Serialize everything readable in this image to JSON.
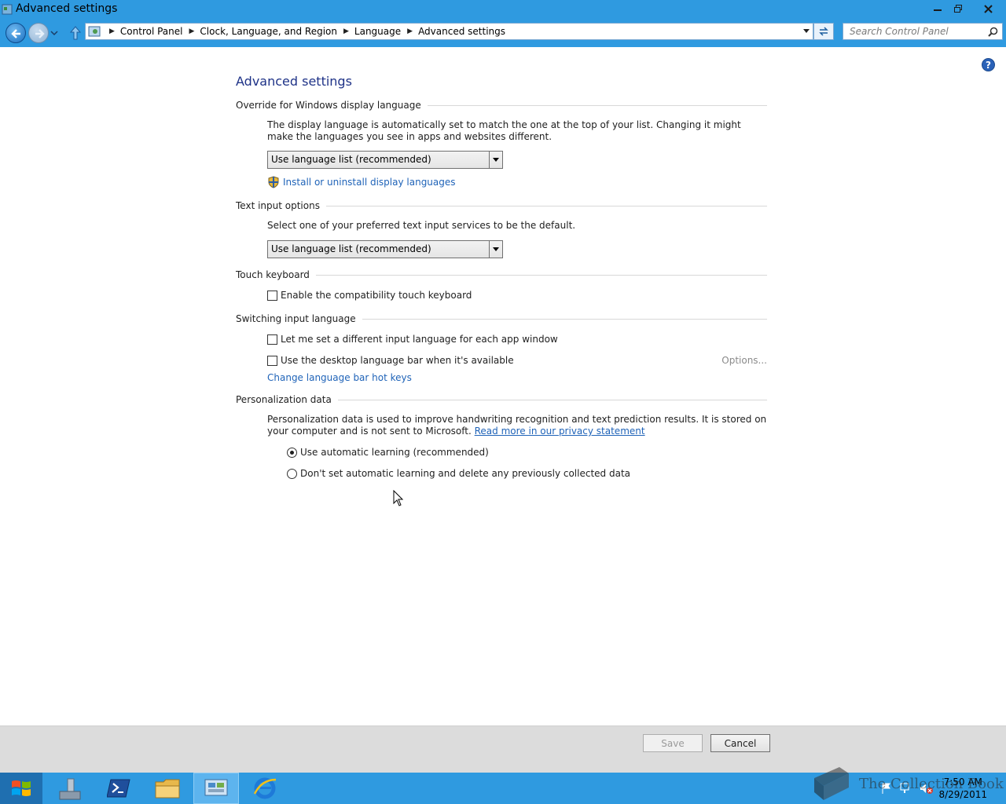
{
  "window": {
    "title": "Advanced settings",
    "minimize_label": "–",
    "restore_label": "▫",
    "close_label": "✕"
  },
  "address_bar": {
    "breadcrumbs": [
      "Control Panel",
      "Clock, Language, and Region",
      "Language",
      "Advanced settings"
    ],
    "search_placeholder": "Search Control Panel"
  },
  "page": {
    "title": "Advanced settings",
    "sections": {
      "display_language": {
        "heading": "Override for Windows display language",
        "description": "The display language is automatically set to match the one at the top of your list. Changing it might make the languages you see in apps and websites different.",
        "dropdown_value": "Use language list (recommended)",
        "link": "Install or uninstall display languages"
      },
      "text_input": {
        "heading": "Text input options",
        "description": "Select one of your preferred text input services to be the default.",
        "dropdown_value": "Use language list (recommended)"
      },
      "touch_keyboard": {
        "heading": "Touch keyboard",
        "checkbox_label": "Enable the compatibility touch keyboard",
        "checked": false
      },
      "switching": {
        "heading": "Switching input language",
        "checkbox1_label": "Let me set a different input language for each app window",
        "checkbox1_checked": false,
        "checkbox2_label": "Use the desktop language bar when it's available",
        "checkbox2_checked": false,
        "options_label": "Options...",
        "hotkeys_link": "Change language bar hot keys"
      },
      "personalization": {
        "heading": "Personalization data",
        "description": "Personalization data is used to improve handwriting recognition and text prediction results. It is stored on your computer and is not sent to Microsoft.",
        "privacy_link": "Read more in our privacy statement",
        "radio1_label": "Use automatic learning (recommended)",
        "radio1_checked": true,
        "radio2_label": "Don't set automatic learning and delete any previously collected data",
        "radio2_checked": false
      }
    }
  },
  "footer": {
    "save_label": "Save",
    "save_enabled": false,
    "cancel_label": "Cancel"
  },
  "taskbar": {
    "time": "7:50 AM",
    "date": "8/29/2011",
    "watermark": "The Collection Book"
  },
  "colors": {
    "accent": "#2f9ae0",
    "title_text": "#1e3287",
    "link": "#1f63b8"
  }
}
